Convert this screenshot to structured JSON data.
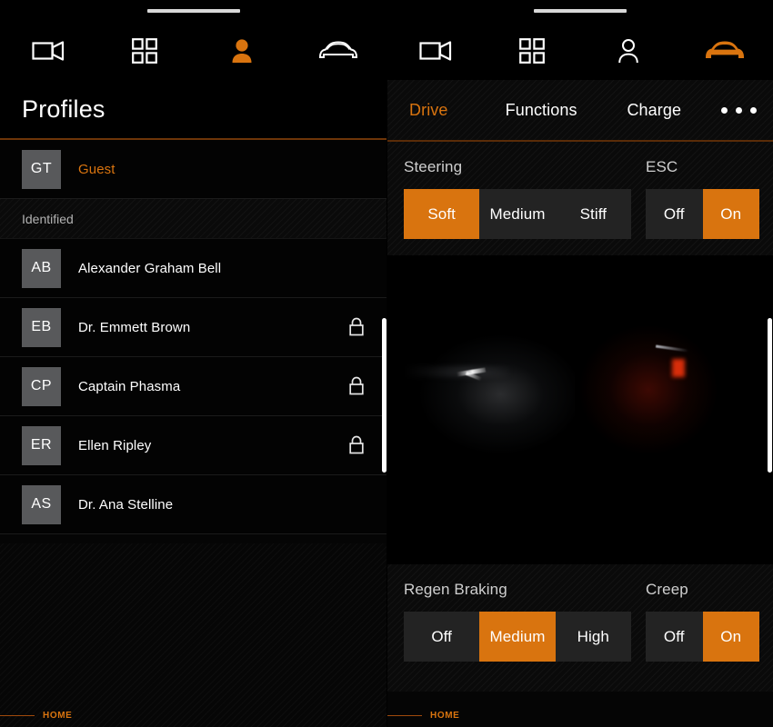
{
  "left_panel": {
    "status_handle": true,
    "nav": [
      {
        "name": "camera-icon",
        "label": "Camera",
        "active": false
      },
      {
        "name": "apps-grid-icon",
        "label": "Apps",
        "active": false
      },
      {
        "name": "person-icon",
        "label": "Profiles",
        "active": true
      },
      {
        "name": "car-icon",
        "label": "Vehicle",
        "active": false
      }
    ],
    "title": "Profiles",
    "guest": {
      "initials": "GT",
      "name": "Guest",
      "locked": false
    },
    "section_label": "Identified",
    "profiles": [
      {
        "initials": "AB",
        "name": "Alexander Graham Bell",
        "locked": false
      },
      {
        "initials": "EB",
        "name": "Dr. Emmett Brown",
        "locked": true
      },
      {
        "initials": "CP",
        "name": "Captain Phasma",
        "locked": true
      },
      {
        "initials": "ER",
        "name": "Ellen Ripley",
        "locked": true
      },
      {
        "initials": "AS",
        "name": "Dr. Ana Stelline",
        "locked": false
      }
    ],
    "home_label": "HOME"
  },
  "right_panel": {
    "status_handle": true,
    "nav": [
      {
        "name": "camera-icon",
        "label": "Camera",
        "active": false
      },
      {
        "name": "apps-grid-icon",
        "label": "Apps",
        "active": false
      },
      {
        "name": "person-icon",
        "label": "Profiles",
        "active": false
      },
      {
        "name": "car-icon",
        "label": "Vehicle",
        "active": true
      }
    ],
    "tabs": [
      {
        "label": "Drive",
        "active": true
      },
      {
        "label": "Functions",
        "active": false
      },
      {
        "label": "Charge",
        "active": false
      }
    ],
    "overflow_label": "More",
    "controls_top": [
      {
        "label": "Steering",
        "options": [
          "Soft",
          "Medium",
          "Stiff"
        ],
        "selected": "Soft"
      },
      {
        "label": "ESC",
        "options": [
          "Off",
          "On"
        ],
        "selected": "On"
      }
    ],
    "controls_bottom": [
      {
        "label": "Regen Braking",
        "options": [
          "Off",
          "Medium",
          "High"
        ],
        "selected": "Medium"
      },
      {
        "label": "Creep",
        "options": [
          "Off",
          "On"
        ],
        "selected": "On"
      }
    ],
    "home_label": "HOME"
  },
  "colors": {
    "accent": "#d9740f",
    "background": "#000000",
    "segment_off": "#232323",
    "avatar": "#58595b",
    "text": "#ffffff",
    "muted": "#b3b3b3"
  }
}
